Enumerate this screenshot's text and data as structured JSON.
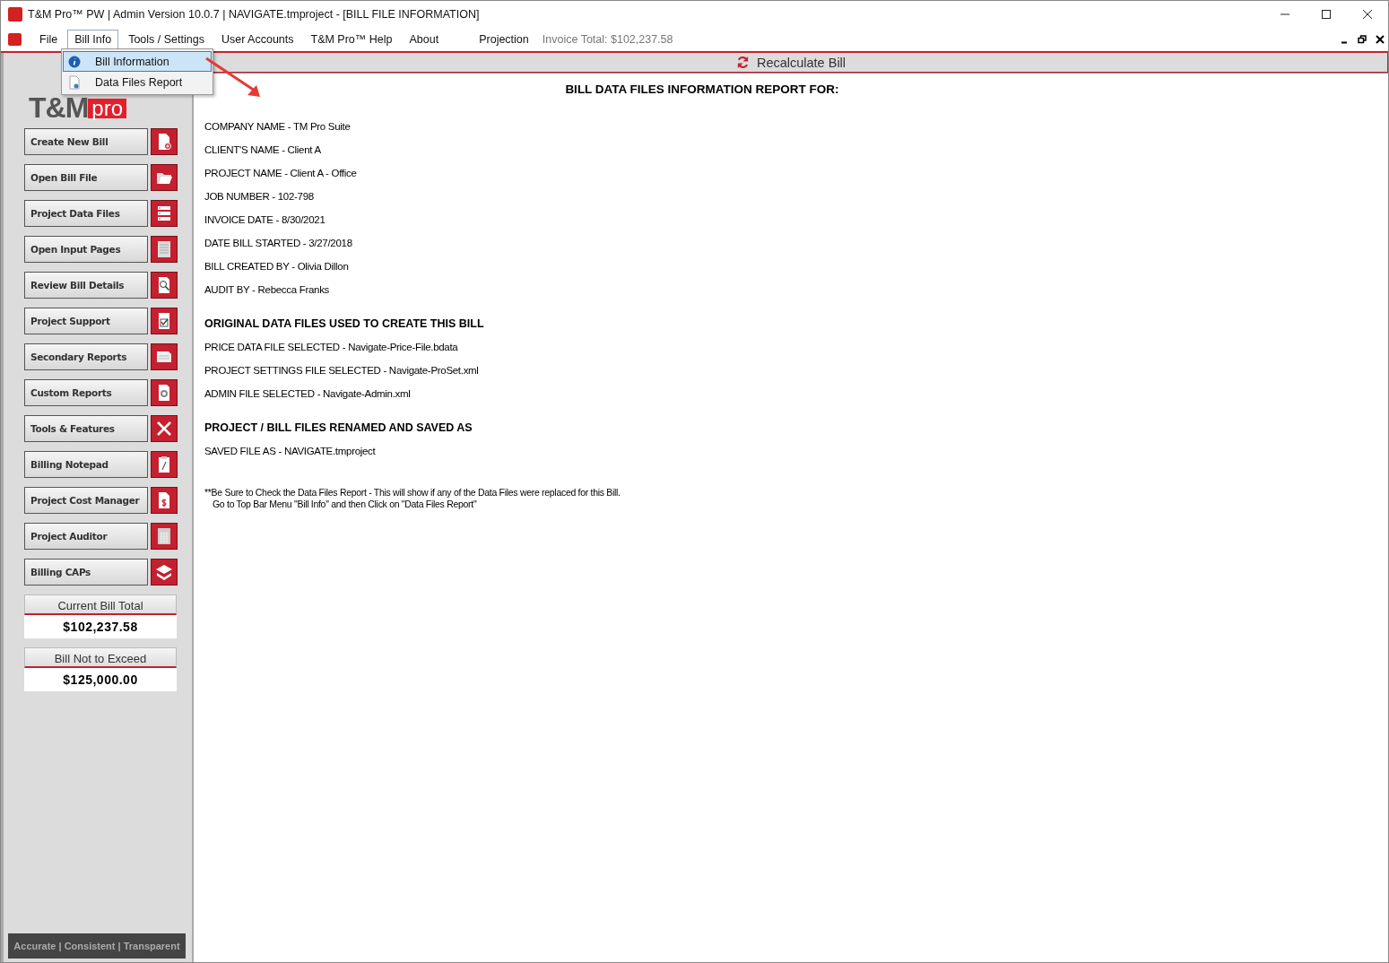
{
  "window": {
    "title": "T&M Pro™ PW | Admin Version 10.0.7 | NAVIGATE.tmproject - [BILL FILE INFORMATION]"
  },
  "menu": [
    {
      "label": "File",
      "selected": false
    },
    {
      "label": "Bill Info",
      "selected": true
    },
    {
      "label": "Tools / Settings",
      "selected": false
    },
    {
      "label": "User Accounts",
      "selected": false
    },
    {
      "label": "T&M Pro™ Help",
      "selected": false
    },
    {
      "label": "About",
      "selected": false
    },
    {
      "label": "Projection",
      "selected": false
    }
  ],
  "invoice_total": "Invoice Total: $102,237.58",
  "dropdown": [
    {
      "label": "Bill Information",
      "selected": true,
      "kind": "info"
    },
    {
      "label": "Data Files Report",
      "selected": false,
      "kind": "report"
    }
  ],
  "recalculate_button": "Recalculate Bill",
  "logo": {
    "main": "T&M",
    "accent": "pro"
  },
  "sidebar": [
    {
      "label": "Create New Bill",
      "kind": "new-file"
    },
    {
      "label": "Open Bill File",
      "kind": "folder"
    },
    {
      "label": "Project Data Files",
      "kind": "list"
    },
    {
      "label": "Open Input Pages",
      "kind": "form"
    },
    {
      "label": "Review Bill Details",
      "kind": "search"
    },
    {
      "label": "Project Support",
      "kind": "check"
    },
    {
      "label": "Secondary Reports",
      "kind": "report"
    },
    {
      "label": "Custom Reports",
      "kind": "gear"
    },
    {
      "label": "Tools & Features",
      "kind": "tools"
    },
    {
      "label": "Billing Notepad",
      "kind": "notepad"
    },
    {
      "label": "Project Cost Manager",
      "kind": "dollar"
    },
    {
      "label": "Project Auditor",
      "kind": "calculator"
    },
    {
      "label": "Billing CAPs",
      "kind": "layers"
    }
  ],
  "totals": [
    {
      "label": "Current Bill Total",
      "value": "$102,237.58"
    },
    {
      "label": "Bill Not to Exceed",
      "value": "$125,000.00"
    }
  ],
  "footer": "Accurate | Consistent | Transparent",
  "report": {
    "title": "BILL DATA FILES INFORMATION REPORT FOR:",
    "lines": [
      {
        "kind": "field",
        "text": "COMPANY NAME - TM Pro Suite"
      },
      {
        "kind": "field",
        "text": "CLIENT'S NAME - Client A"
      },
      {
        "kind": "field",
        "text": "PROJECT NAME - Client A - Office"
      },
      {
        "kind": "field",
        "text": "JOB NUMBER - 102-798"
      },
      {
        "kind": "field",
        "text": "INVOICE DATE - 8/30/2021"
      },
      {
        "kind": "field",
        "text": "DATE BILL STARTED - 3/27/2018"
      },
      {
        "kind": "field",
        "text": "BILL CREATED BY - Olivia Dillon"
      },
      {
        "kind": "field",
        "text": "AUDIT BY - Rebecca Franks"
      },
      {
        "kind": "heading",
        "text": "ORIGINAL DATA FILES USED TO CREATE THIS BILL"
      },
      {
        "kind": "field",
        "text": "PRICE DATA FILE SELECTED - Navigate-Price-File.bdata"
      },
      {
        "kind": "field",
        "text": "PROJECT SETTINGS FILE SELECTED - Navigate-ProSet.xml"
      },
      {
        "kind": "field",
        "text": "ADMIN FILE SELECTED - Navigate-Admin.xml"
      },
      {
        "kind": "heading",
        "text": "PROJECT / BILL FILES RENAMED AND SAVED AS"
      },
      {
        "kind": "field",
        "text": "SAVED FILE AS - NAVIGATE.tmproject"
      }
    ],
    "notes": [
      "**Be Sure to Check the Data Files Report - This will show if any of the Data Files were replaced for this Bill.",
      "Go to Top Bar Menu \"Bill Info\" and then Click on  \"Data Files Report\""
    ]
  }
}
